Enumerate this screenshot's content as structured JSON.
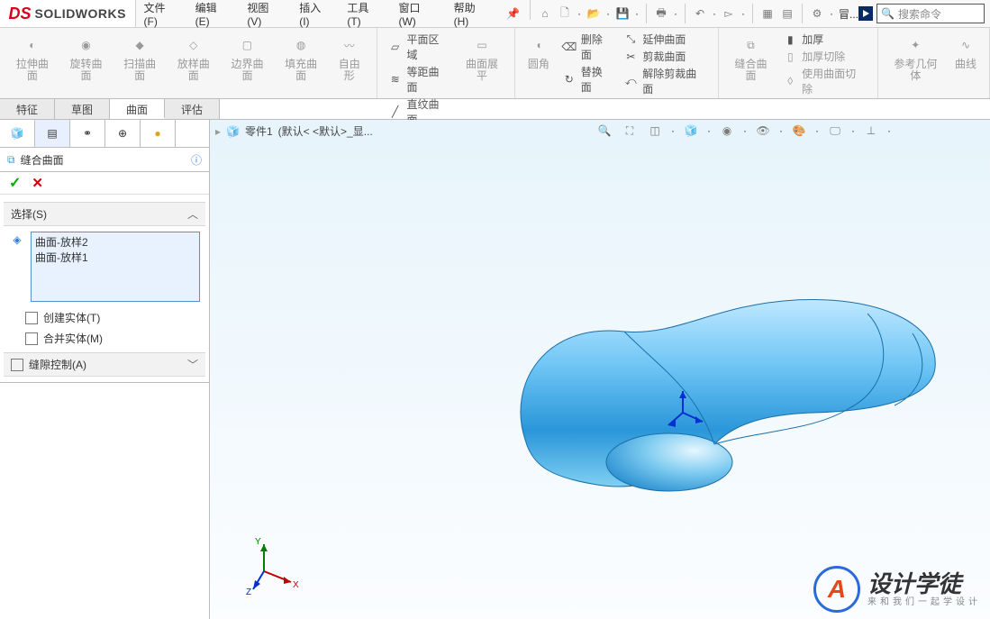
{
  "app": {
    "brand_ds": "DS",
    "brand_name": "SOLIDWORKS"
  },
  "menu": {
    "file": "文件(F)",
    "edit": "编辑(E)",
    "view": "视图(V)",
    "insert": "插入(I)",
    "tools": "工具(T)",
    "window": "窗口(W)",
    "help": "帮助(H)"
  },
  "search": {
    "placeholder": "搜索命令"
  },
  "ribbon": {
    "ext": "拉伸曲面",
    "rev": "旋转曲面",
    "sweep": "扫描曲面",
    "loft": "放样曲面",
    "bound": "边界曲面",
    "fill": "填充曲面",
    "free": "自由形",
    "planar": "平面区域",
    "offset": "等距曲面",
    "ruled": "直纹曲面",
    "flatten": "曲面展平",
    "fillet": "圆角",
    "delface": "删除面",
    "replface": "替换面",
    "extface": "延伸曲面",
    "trimface": "剪裁曲面",
    "untrim": "解除剪裁曲面",
    "knit": "缝合曲面",
    "thicken": "加厚",
    "thickcut": "加厚切除",
    "surfcut": "使用曲面切除",
    "refgeo": "参考几何体",
    "curves": "曲线"
  },
  "tabs": {
    "feat": "特征",
    "sketch": "草图",
    "surface": "曲面",
    "eval": "评估"
  },
  "breadcrumb": {
    "part": "零件1",
    "state": "(默认< <默认>_显..."
  },
  "panel": {
    "title": "缝合曲面",
    "select_title": "选择(S)",
    "items": [
      "曲面-放样2",
      "曲面-放样1"
    ],
    "chk_solid": "创建实体(T)",
    "chk_merge": "合并实体(M)",
    "gap_title": "缝隙控制(A)"
  },
  "qat_extra": "冒...",
  "watermark": {
    "big": "设计学徒",
    "small": "来和我们一起学设计"
  }
}
